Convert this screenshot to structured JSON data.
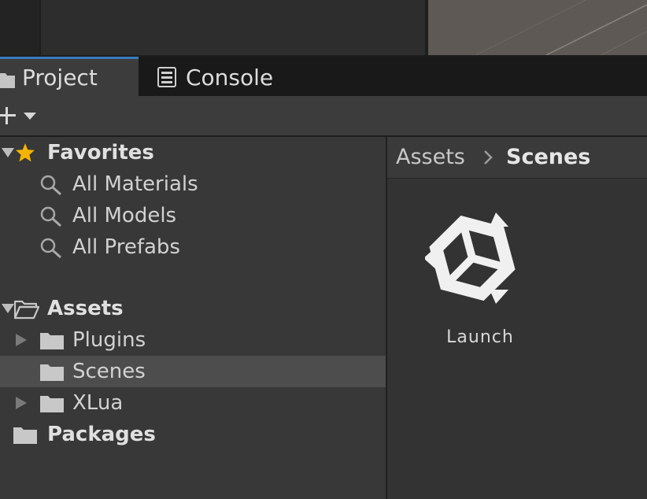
{
  "tabs": [
    {
      "label": "Project",
      "icon": "folder-icon",
      "active": true
    },
    {
      "label": "Console",
      "icon": "console-icon",
      "active": false
    }
  ],
  "toolbar": {
    "add_icon": "plus-icon",
    "dropdown_icon": "caret-down-icon"
  },
  "tree": {
    "favorites": {
      "label": "Favorites",
      "icon": "star-icon",
      "items": [
        {
          "label": "All Materials",
          "icon": "search-icon"
        },
        {
          "label": "All Models",
          "icon": "search-icon"
        },
        {
          "label": "All Prefabs",
          "icon": "search-icon"
        }
      ]
    },
    "assets": {
      "label": "Assets",
      "icon": "folder-open-icon",
      "children": [
        {
          "label": "Plugins",
          "icon": "folder-icon",
          "has_children": true,
          "selected": false
        },
        {
          "label": "Scenes",
          "icon": "folder-icon",
          "has_children": false,
          "selected": true
        },
        {
          "label": "XLua",
          "icon": "folder-icon",
          "has_children": true,
          "selected": false
        }
      ]
    },
    "packages": {
      "label": "Packages",
      "icon": "folder-icon"
    }
  },
  "breadcrumb": {
    "root": "Assets",
    "separator_icon": "chevron-right-icon",
    "current": "Scenes"
  },
  "assets_grid": [
    {
      "label": "Launch",
      "icon": "unity-scene-icon"
    }
  ],
  "colors": {
    "accent": "#3a79bb",
    "star": "#f4b400",
    "selected_row": "#4d4d4d"
  }
}
